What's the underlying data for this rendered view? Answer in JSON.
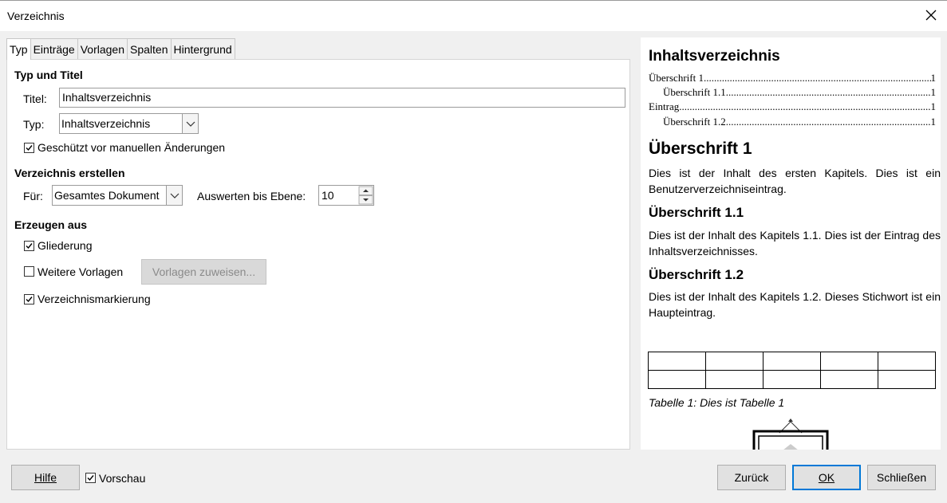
{
  "window": {
    "title": "Verzeichnis"
  },
  "tabs": [
    {
      "label": "Typ",
      "active": true
    },
    {
      "label": "Einträge"
    },
    {
      "label": "Vorlagen"
    },
    {
      "label": "Spalten"
    },
    {
      "label": "Hintergrund"
    }
  ],
  "typ_und_titel": {
    "heading": "Typ und Titel",
    "title_label": "Titel:",
    "title_value": "Inhaltsverzeichnis",
    "type_label": "Typ:",
    "type_value": "Inhaltsverzeichnis",
    "protected_label": "Geschützt vor manuellen Änderungen",
    "protected_checked": true
  },
  "verzeichnis_erstellen": {
    "heading": "Verzeichnis erstellen",
    "for_label": "Für:",
    "for_value": "Gesamtes Dokument",
    "level_label": "Auswerten bis Ebene:",
    "level_value": "10"
  },
  "erzeugen_aus": {
    "heading": "Erzeugen aus",
    "outline_label": "Gliederung",
    "outline_checked": true,
    "more_styles_label": "Weitere Vorlagen",
    "more_styles_checked": false,
    "assign_styles_button": "Vorlagen zuweisen...",
    "index_marks_label": "Verzeichnismarkierung",
    "index_marks_checked": true
  },
  "preview": {
    "title": "Inhaltsverzeichnis",
    "toc": [
      {
        "text": "Überschrift 1",
        "page": "1",
        "indent": 0
      },
      {
        "text": "Überschrift 1.1",
        "page": "1",
        "indent": 1
      },
      {
        "text": "Eintrag",
        "page": "1",
        "indent": 0
      },
      {
        "text": "Überschrift 1.2",
        "page": "1",
        "indent": 1
      }
    ],
    "h1": "Überschrift 1",
    "p1": "Dies ist der Inhalt des ersten Kapitels. Dies ist ein Benutzerverzeichniseintrag.",
    "h2a": "Überschrift 1.1",
    "p2": "Dies ist der Inhalt des Kapitels 1.1. Dies ist der Eintrag des Inhaltsverzeichnisses.",
    "h2b": "Überschrift 1.2",
    "p3": "Dies ist der Inhalt des Kapitels 1.2. Dieses Stichwort ist ein Haupteintrag.",
    "table_caption": "Tabelle 1: Dies ist Tabelle 1"
  },
  "footer": {
    "help_button": "Hilfe",
    "preview_label": "Vorschau",
    "preview_checked": true,
    "back_button": "Zurück",
    "ok_button": "OK",
    "close_button": "Schließen"
  }
}
